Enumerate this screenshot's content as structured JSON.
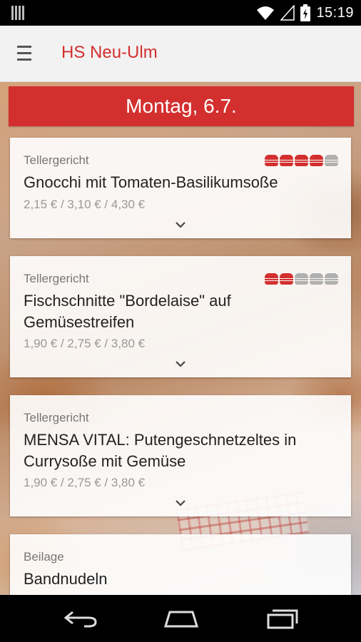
{
  "status_bar": {
    "time": "15:19",
    "icons": [
      "signal-bars-icon",
      "wifi-icon",
      "cell-signal-icon",
      "battery-charging-icon"
    ]
  },
  "app_bar": {
    "title": "HS Neu-Ulm",
    "menu_icon": "hamburger-menu-icon"
  },
  "day": {
    "label": "Montag, 6.7."
  },
  "colors": {
    "accent": "#d32f2f",
    "rating_inactive": "#b0b0b0"
  },
  "meals": [
    {
      "category": "Tellergericht",
      "title": "Gnocchi mit Tomaten-Basilikumsoße",
      "prices": "2,15 € / 3,10 € / 4,30 €",
      "rating": 4,
      "rating_max": 5
    },
    {
      "category": "Tellergericht",
      "title": "Fischschnitte \"Bordelaise\" auf Gemüsestreifen",
      "prices": "1,90 € / 2,75 € / 3,80 €",
      "rating": 2,
      "rating_max": 5
    },
    {
      "category": "Tellergericht",
      "title": "MENSA VITAL: Putengeschnetzeltes in Currysoße mit Gemüse",
      "prices": "1,90 € / 2,75 € / 3,80 €"
    },
    {
      "category": "Beilage",
      "title": "Bandnudeln"
    }
  ],
  "nav_bar": {
    "buttons": [
      "back-icon",
      "home-icon",
      "recent-apps-icon"
    ]
  }
}
